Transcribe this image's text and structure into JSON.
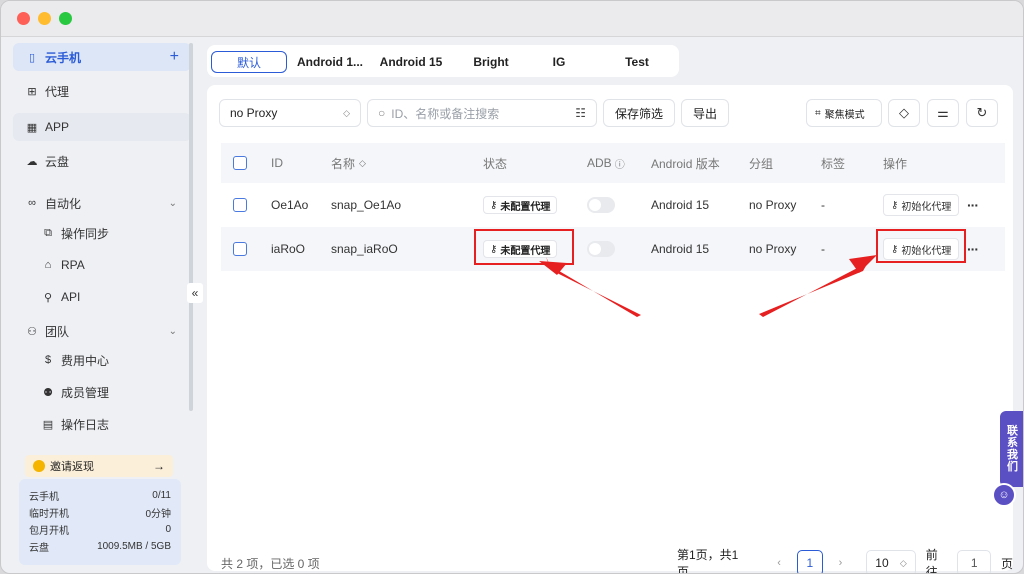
{
  "sidebar": {
    "cloud_phone": "云手机",
    "proxy": "代理",
    "app": "APP",
    "cloud_disk": "云盘",
    "automation": "自动化",
    "auto_items": [
      "操作同步",
      "RPA",
      "API"
    ],
    "team": "团队",
    "team_items": [
      "费用中心",
      "成员管理",
      "操作日志"
    ],
    "invite": "邀请返现",
    "quota": [
      {
        "label": "云手机",
        "value": "0/11"
      },
      {
        "label": "临时开机",
        "value": "0分钟"
      },
      {
        "label": "包月开机",
        "value": "0"
      },
      {
        "label": "云盘",
        "value": "1009.5MB / 5GB"
      }
    ]
  },
  "tabs": [
    "默认",
    "Android 1...",
    "Android 15",
    "Bright",
    "IG",
    "Test"
  ],
  "toolbar": {
    "proxy_filter": "no Proxy",
    "search_placeholder": "ID、名称或备注搜索",
    "save_filter": "保存筛选",
    "export": "导出",
    "focus_mode": "聚焦模式"
  },
  "table": {
    "headers": [
      "ID",
      "名称",
      "状态",
      "ADB",
      "Android 版本",
      "分组",
      "标签",
      "操作"
    ],
    "rows": [
      {
        "id": "Oe1Ao",
        "name": "snap_Oe1Ao",
        "status": "未配置代理",
        "android": "Android 15",
        "group": "no Proxy",
        "tag": "-",
        "action": "初始化代理"
      },
      {
        "id": "iaRoO",
        "name": "snap_iaRoO",
        "status": "未配置代理",
        "android": "Android 15",
        "group": "no Proxy",
        "tag": "-",
        "action": "初始化代理"
      }
    ]
  },
  "footer": {
    "summary": "共 2 项，已选 0 项",
    "page_info": "第1页，共1页",
    "current_page": "1",
    "page_size": "10",
    "goto_label": "前往",
    "goto_value": "1",
    "page_suffix": "页"
  },
  "contact": [
    "联",
    "系",
    "我",
    "们"
  ],
  "colors": {
    "accent": "#2b5bd7",
    "highlight": "#e62020",
    "contact": "#5b4fc4"
  }
}
